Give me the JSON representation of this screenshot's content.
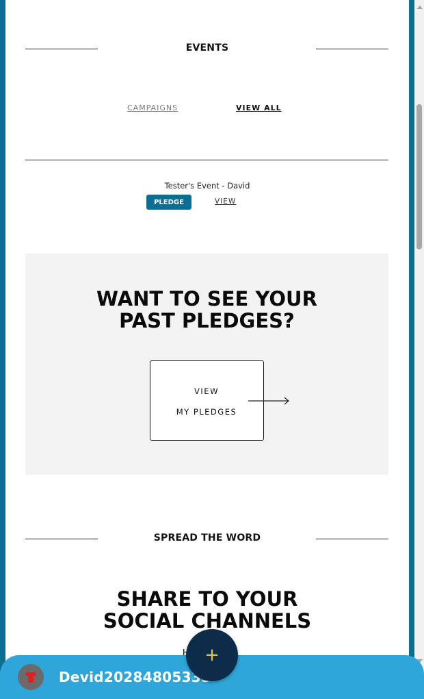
{
  "events_section": {
    "title": "EVENTS"
  },
  "tabs": {
    "campaigns": "CAMPAIGNS",
    "view_all": "VIEW ALL"
  },
  "event": {
    "name": "Tester's Event - David",
    "pledge_label": "PLEDGE",
    "view_label": "VIEW"
  },
  "past_pledges": {
    "heading_line1": "WANT TO SEE YOUR",
    "heading_line2": "PAST PLEDGES?",
    "card_line1": "VIEW",
    "card_line2": "MY PLEDGES"
  },
  "spread_section": {
    "title": "SPREAD THE WORD"
  },
  "share": {
    "heading_line1": "SHARE TO YOUR",
    "heading_line2": "SOCIAL CHANNELS",
    "text": "Hello Hello"
  },
  "bottom_bar": {
    "username": "Devid20284805335",
    "fab_label": "+"
  },
  "colors": {
    "brand": "#0b6e93",
    "bar": "#2ea6d9",
    "fab": "#0d2c4a",
    "fab_plus": "#f1c232"
  }
}
